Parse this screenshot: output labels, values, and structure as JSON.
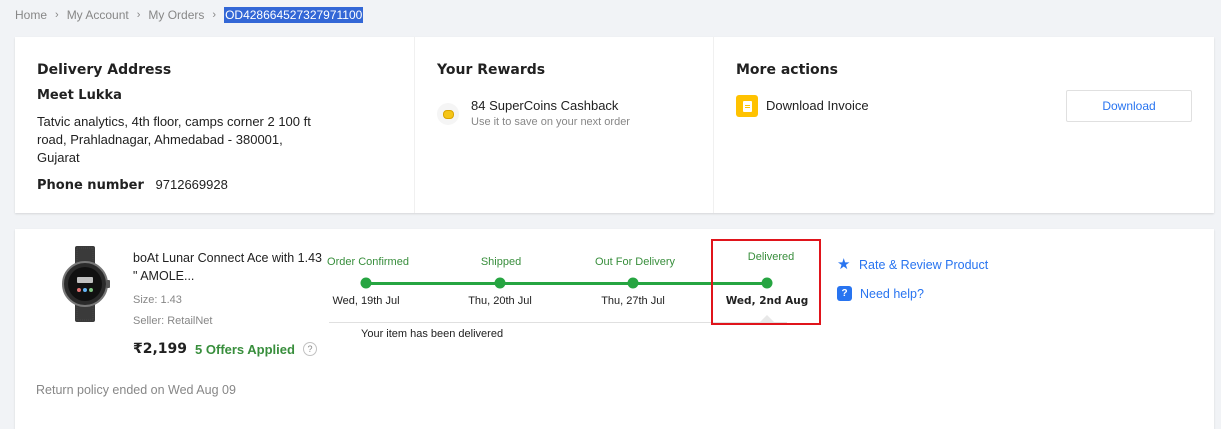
{
  "breadcrumb": {
    "items": [
      "Home",
      "My Account",
      "My Orders"
    ],
    "current": "OD428664527327971100",
    "separator": "›"
  },
  "delivery": {
    "title": "Delivery Address",
    "name": "Meet Lukka",
    "address": "Tatvic analytics, 4th floor, camps corner 2 100 ft road, Prahladnagar, Ahmedabad - 380001, Gujarat",
    "phone_label": "Phone number",
    "phone": "9712669928"
  },
  "rewards": {
    "title": "Your Rewards",
    "icon": "supercoin-icon",
    "headline": "84 SuperCoins Cashback",
    "subtext": "Use it to save on your next order"
  },
  "actions": {
    "title": "More actions",
    "icon": "invoice-icon",
    "invoice_label": "Download Invoice",
    "download_button": "Download"
  },
  "product": {
    "name": "boAt Lunar Connect Ace with 1.43 \" AMOLE...",
    "size": "Size: 1.43",
    "seller": "Seller: RetailNet",
    "price": "₹2,199",
    "offers": "5 Offers Applied",
    "help_glyph": "?"
  },
  "tracking": {
    "stages": [
      {
        "label": "Order Confirmed",
        "date": "Wed, 19th Jul"
      },
      {
        "label": "Shipped",
        "date": "Thu, 20th Jul"
      },
      {
        "label": "Out For Delivery",
        "date": "Thu, 27th Jul"
      },
      {
        "label": "Delivered",
        "date": "Wed, 2nd Aug"
      }
    ],
    "status_message": "Your item has been delivered",
    "accent_color": "#26a541",
    "highlight_color": "#e0141b"
  },
  "side_actions": {
    "rate_label": "Rate & Review Product",
    "rate_icon": "star-icon",
    "help_label": "Need help?",
    "help_icon": "help-icon",
    "help_glyph": "?"
  },
  "return_policy": "Return policy ended on Wed Aug 09",
  "colors": {
    "link": "#2874f0",
    "success": "#388e3c",
    "muted": "#878787",
    "selection": "#3367d6"
  }
}
